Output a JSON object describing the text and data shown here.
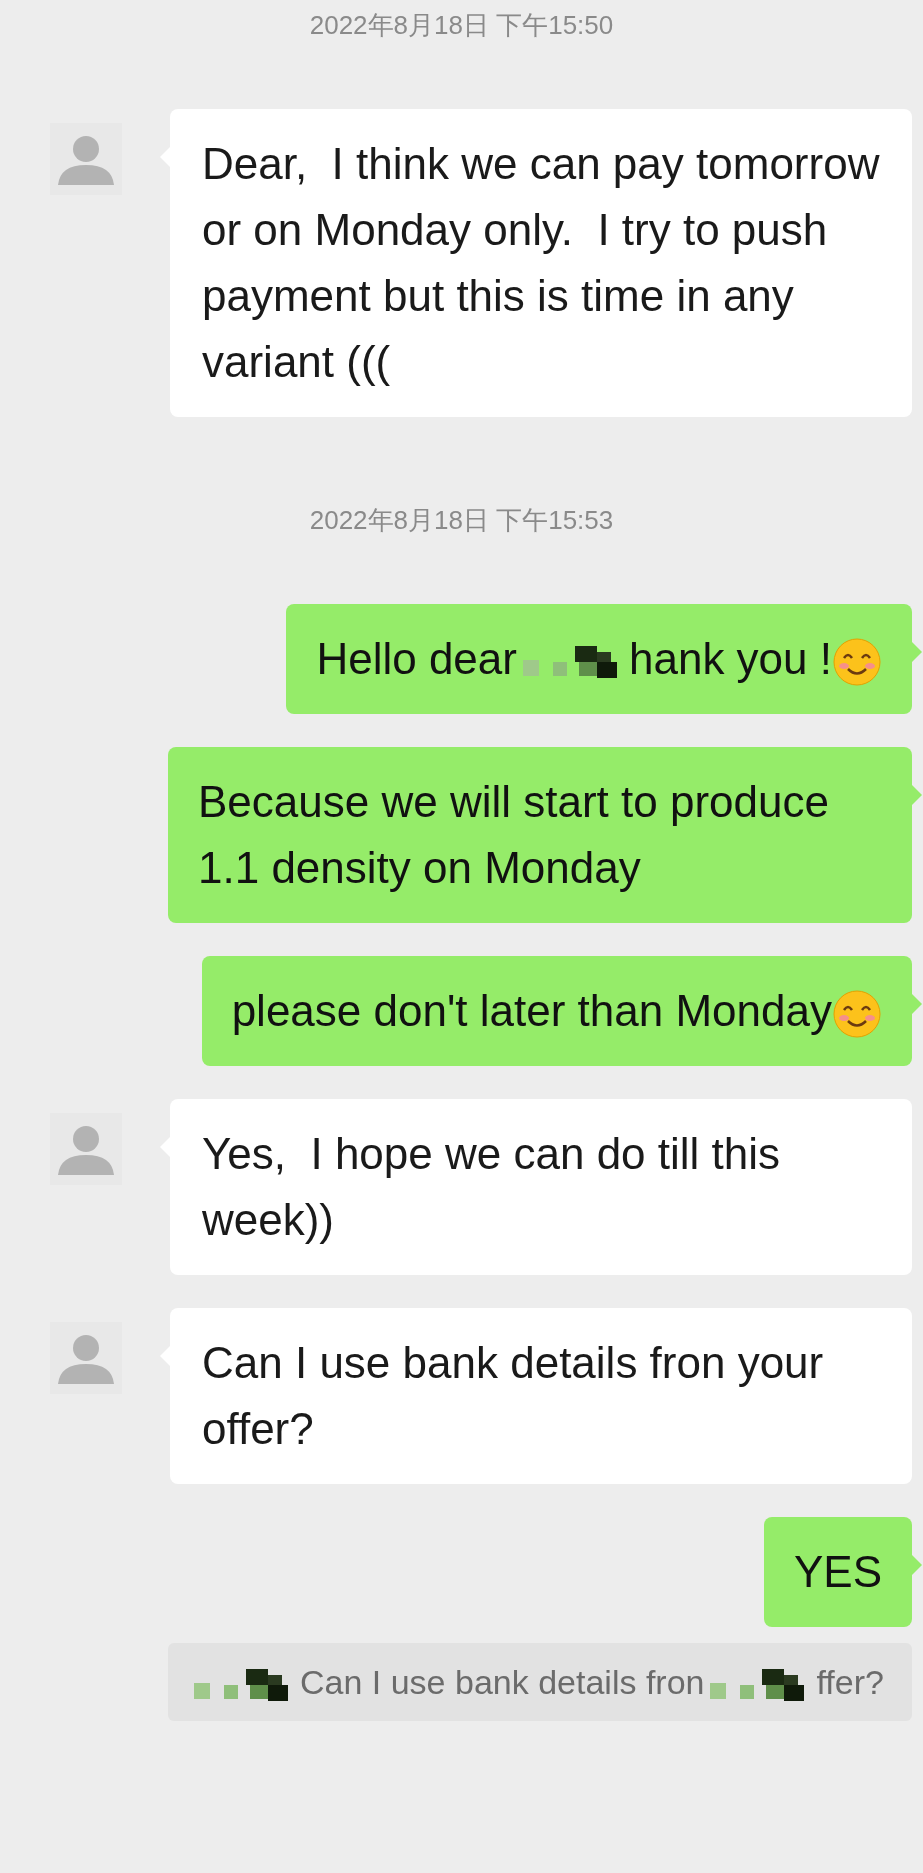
{
  "messages": [
    {
      "kind": "timestamp",
      "text": "2022年8月18日 下午15:50"
    },
    {
      "kind": "incoming",
      "parts": [
        {
          "kind": "text",
          "text": "Dear,  I think we can pay tomorrow or on Monday only.  I try to push payment but this is time in any variant ((("
        }
      ]
    },
    {
      "kind": "timestamp",
      "text": "2022年8月18日 下午15:53"
    },
    {
      "kind": "outgoing",
      "parts": [
        {
          "kind": "text",
          "text": "Hello dear"
        },
        {
          "kind": "mosaic"
        },
        {
          "kind": "text",
          "text": "hank you !"
        },
        {
          "kind": "emoji"
        }
      ]
    },
    {
      "kind": "outgoing",
      "parts": [
        {
          "kind": "text",
          "text": "Because we will start to produce 1.1 density on Monday"
        }
      ]
    },
    {
      "kind": "outgoing",
      "parts": [
        {
          "kind": "text",
          "text": "please don't later than Monday"
        },
        {
          "kind": "emoji"
        }
      ]
    },
    {
      "kind": "incoming",
      "parts": [
        {
          "kind": "text",
          "text": "Yes,  I hope we can do till this week))"
        }
      ]
    },
    {
      "kind": "incoming",
      "parts": [
        {
          "kind": "text",
          "text": "Can I use bank details fron your offer?"
        }
      ]
    },
    {
      "kind": "outgoing",
      "parts": [
        {
          "kind": "text",
          "text": "YES"
        }
      ]
    },
    {
      "kind": "quote",
      "parts": [
        {
          "kind": "mosaic"
        },
        {
          "kind": "text",
          "text": "Can I use bank details fron"
        },
        {
          "kind": "mosaic"
        },
        {
          "kind": "text",
          "text": "ffer?"
        }
      ]
    }
  ]
}
